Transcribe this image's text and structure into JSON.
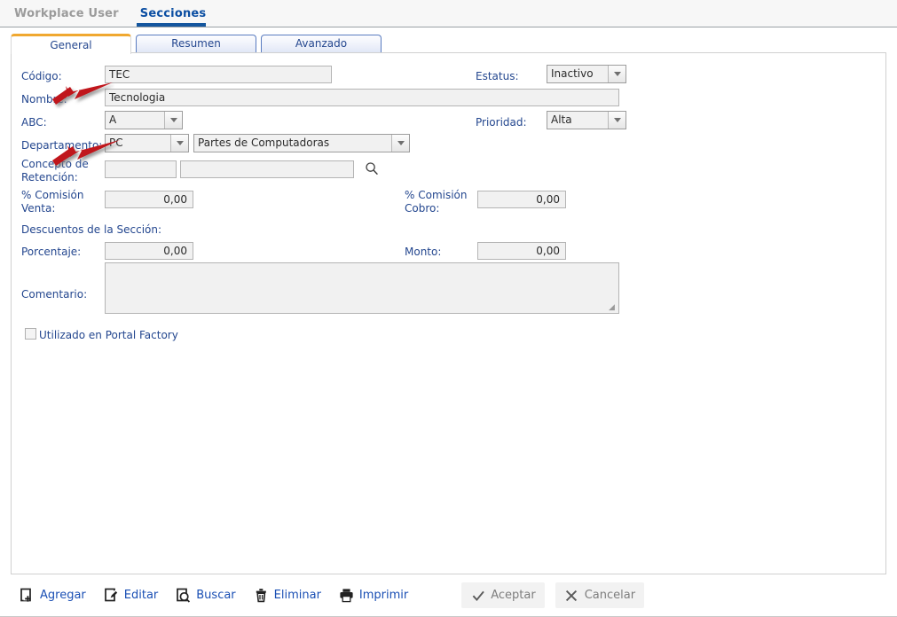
{
  "header": {
    "breadcrumb_parent": "Workplace User",
    "breadcrumb_current": "Secciones"
  },
  "tabs": [
    {
      "label": "General",
      "active": true
    },
    {
      "label": "Resumen",
      "active": false
    },
    {
      "label": "Avanzado",
      "active": false
    }
  ],
  "form": {
    "codigo": {
      "label": "Código:",
      "value": "TEC"
    },
    "estatus": {
      "label": "Estatus:",
      "value": "Inactivo"
    },
    "nombre": {
      "label": "Nombre:",
      "value": "Tecnologia"
    },
    "abc": {
      "label": "ABC:",
      "value": "A"
    },
    "prioridad": {
      "label": "Prioridad:",
      "value": "Alta"
    },
    "departamento": {
      "label": "Departamento:",
      "code": "PC",
      "name": "Partes de Computadoras"
    },
    "concepto_retencion": {
      "label": "Concepto de\nRetención:",
      "code": "",
      "name": ""
    },
    "comision_venta": {
      "label": "% Comisión\nVenta:",
      "value": "0,00"
    },
    "comision_cobro": {
      "label": "% Comisión\nCobro:",
      "value": "0,00"
    },
    "descuentos_title": "Descuentos de la Sección:",
    "porcentaje": {
      "label": "Porcentaje:",
      "value": "0,00"
    },
    "monto": {
      "label": "Monto:",
      "value": "0,00"
    },
    "comentario": {
      "label": "Comentario:",
      "value": ""
    },
    "portal_factory": {
      "label": "Utilizado en Portal Factory",
      "checked": false
    }
  },
  "toolbar": {
    "agregar": "Agregar",
    "editar": "Editar",
    "buscar": "Buscar",
    "eliminar": "Eliminar",
    "imprimir": "Imprimir",
    "aceptar": "Aceptar",
    "cancelar": "Cancelar"
  },
  "colors": {
    "accent_blue": "#24478f",
    "link_blue": "#1a4fb4",
    "active_tab_top": "#f0a830",
    "nav_underline": "#14569e",
    "arrow_red": "#c0121a"
  }
}
